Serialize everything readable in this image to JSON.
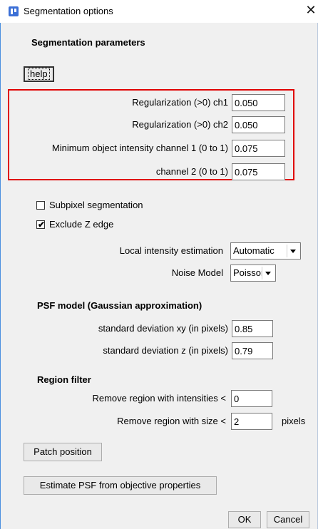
{
  "window": {
    "title": "Segmentation options",
    "close_glyph": "✕"
  },
  "sections": {
    "segmentation_parameters": "Segmentation parameters",
    "psf_model": "PSF model (Gaussian approximation)",
    "region_filter": "Region filter"
  },
  "help_button": "help",
  "regularization": [
    {
      "label": "Regularization (>0) ch1",
      "value": "0.050"
    },
    {
      "label": "Regularization (>0) ch2",
      "value": "0.050"
    },
    {
      "label": "Minimum object intensity channel 1 (0 to 1)",
      "value": "0.075"
    },
    {
      "label": "channel 2 (0 to 1)",
      "value": "0.075"
    }
  ],
  "checkboxes": [
    {
      "label": "Subpixel segmentation",
      "checked": false,
      "mark": ""
    },
    {
      "label": "Exclude Z edge",
      "checked": true,
      "mark": "✔"
    }
  ],
  "local_intensity": {
    "label": "Local intensity estimation",
    "value": "Automatic"
  },
  "noise_model": {
    "label": "Noise Model",
    "value": "Poisson"
  },
  "psf": {
    "sd_xy": {
      "label": "standard deviation xy (in pixels)",
      "value": "0.85"
    },
    "sd_z": {
      "label": "standard deviation z  (in pixels)",
      "value": "0.79"
    }
  },
  "region": {
    "intensity": {
      "label": "Remove region with intensities <",
      "value": "0"
    },
    "size": {
      "label": "Remove region with size <",
      "value": "2",
      "unit": "pixels"
    }
  },
  "buttons": {
    "patch_position": "Patch position",
    "estimate_psf": "Estimate PSF from objective properties",
    "ok": "OK",
    "cancel": "Cancel"
  },
  "colors": {
    "highlight": "#e00000",
    "icon": "#3b6fd6"
  }
}
